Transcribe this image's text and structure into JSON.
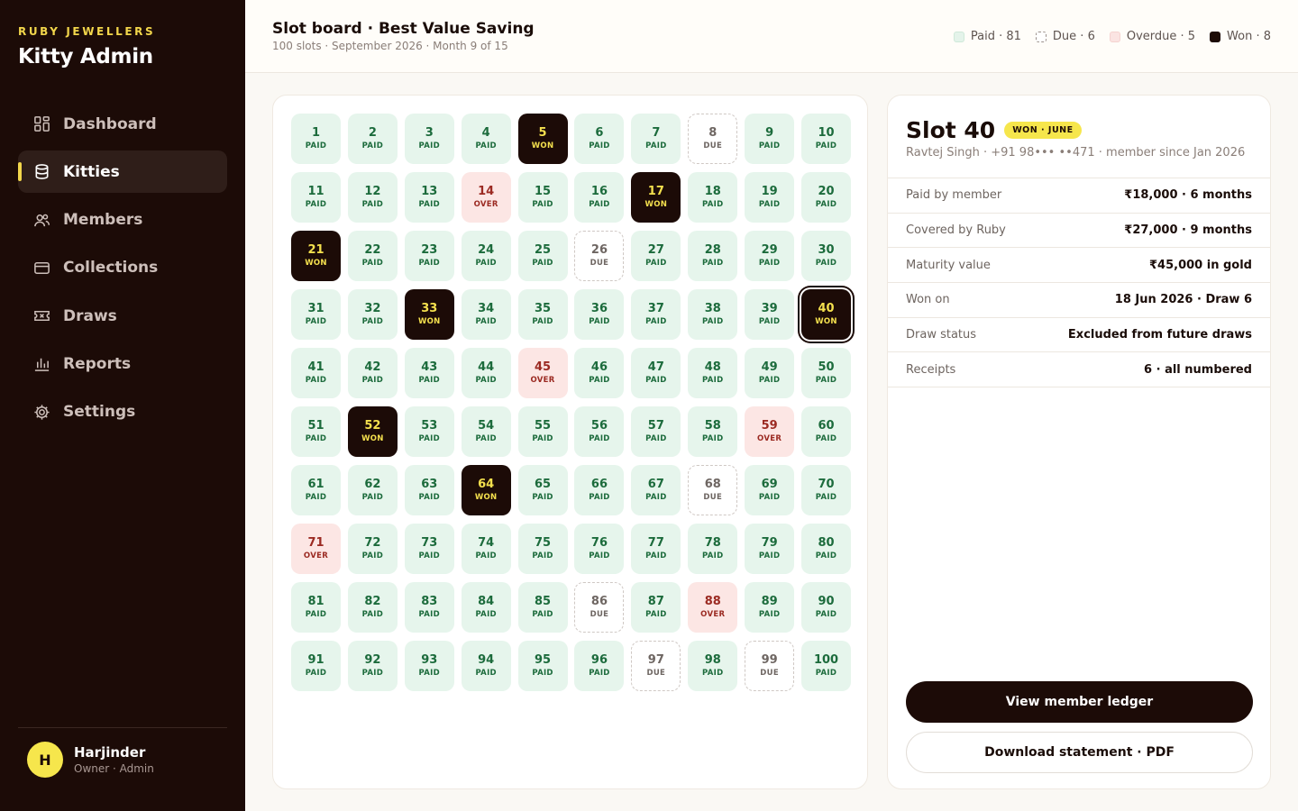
{
  "brand": {
    "company": "RUBY JEWELLERS",
    "app": "Kitty Admin"
  },
  "nav": [
    {
      "label": "Dashboard",
      "icon": "dashboard-icon",
      "active": false
    },
    {
      "label": "Kitties",
      "icon": "database-icon",
      "active": true
    },
    {
      "label": "Members",
      "icon": "members-icon",
      "active": false
    },
    {
      "label": "Collections",
      "icon": "card-icon",
      "active": false
    },
    {
      "label": "Draws",
      "icon": "ticket-icon",
      "active": false
    },
    {
      "label": "Reports",
      "icon": "chart-icon",
      "active": false
    },
    {
      "label": "Settings",
      "icon": "gear-icon",
      "active": false
    }
  ],
  "user": {
    "initial": "H",
    "name": "Harjinder",
    "role": "Owner · Admin"
  },
  "header": {
    "title": "Slot board · Best Value Saving",
    "subtitle": "100 slots · September 2026 · Month 9 of 15"
  },
  "legend": [
    {
      "key": "paid",
      "label": "Paid · 81"
    },
    {
      "key": "due",
      "label": "Due · 6"
    },
    {
      "key": "over",
      "label": "Overdue · 5"
    },
    {
      "key": "won",
      "label": "Won · 8"
    }
  ],
  "status_labels": {
    "paid": "PAID",
    "due": "DUE",
    "over": "OVER",
    "won": "WON"
  },
  "slots": {
    "won": [
      5,
      17,
      21,
      33,
      40,
      52,
      64
    ],
    "due": [
      8,
      26,
      68,
      86,
      97,
      99
    ],
    "over": [
      14,
      45,
      59,
      71,
      88
    ],
    "selected": 40,
    "total": 100
  },
  "detail": {
    "title": "Slot 40",
    "badge": "WON · JUNE",
    "subtitle": "Ravtej Singh · +91 98••• ••471 · member since Jan 2026",
    "rows": [
      {
        "label": "Paid by member",
        "value": "₹18,000 · 6 months"
      },
      {
        "label": "Covered by Ruby",
        "value": "₹27,000 · 9 months"
      },
      {
        "label": "Maturity value",
        "value": "₹45,000 in gold"
      },
      {
        "label": "Won on",
        "value": "18 Jun 2026 · Draw 6"
      },
      {
        "label": "Draw status",
        "value": "Excluded from future draws"
      },
      {
        "label": "Receipts",
        "value": "6 · all numbered"
      }
    ],
    "primary_button": "View member ledger",
    "secondary_button": "Download statement · PDF"
  },
  "colors": {
    "accent": "#f6e64c",
    "dark": "#1c0b07",
    "paid": "#e6f5ec",
    "over": "#fce6e4"
  }
}
